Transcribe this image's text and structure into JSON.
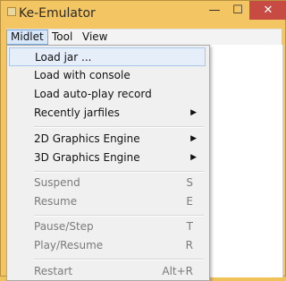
{
  "window": {
    "title": "Ke-Emulator",
    "min_glyph": "—",
    "max_glyph": "☐",
    "close_glyph": "✕"
  },
  "menubar": {
    "items": [
      "Midlet",
      "Tool",
      "View"
    ]
  },
  "dropdown": {
    "items": [
      {
        "label": "Load jar ...",
        "shortcut": "",
        "submenu": false,
        "disabled": false
      },
      {
        "label": "Load with console",
        "shortcut": "",
        "submenu": false,
        "disabled": false
      },
      {
        "label": "Load auto-play record",
        "shortcut": "",
        "submenu": false,
        "disabled": false
      },
      {
        "label": "Recently jarfiles",
        "shortcut": "",
        "submenu": true,
        "disabled": false
      },
      {
        "label": "2D Graphics Engine",
        "shortcut": "",
        "submenu": true,
        "disabled": false
      },
      {
        "label": "3D Graphics Engine",
        "shortcut": "",
        "submenu": true,
        "disabled": false
      },
      {
        "label": "Suspend",
        "shortcut": "S",
        "submenu": false,
        "disabled": true
      },
      {
        "label": "Resume",
        "shortcut": "E",
        "submenu": false,
        "disabled": true
      },
      {
        "label": "Pause/Step",
        "shortcut": "T",
        "submenu": false,
        "disabled": true
      },
      {
        "label": "Play/Resume",
        "shortcut": "R",
        "submenu": false,
        "disabled": true
      },
      {
        "label": "Restart",
        "shortcut": "Alt+R",
        "submenu": false,
        "disabled": true
      }
    ],
    "submenu_arrow": "▶"
  }
}
